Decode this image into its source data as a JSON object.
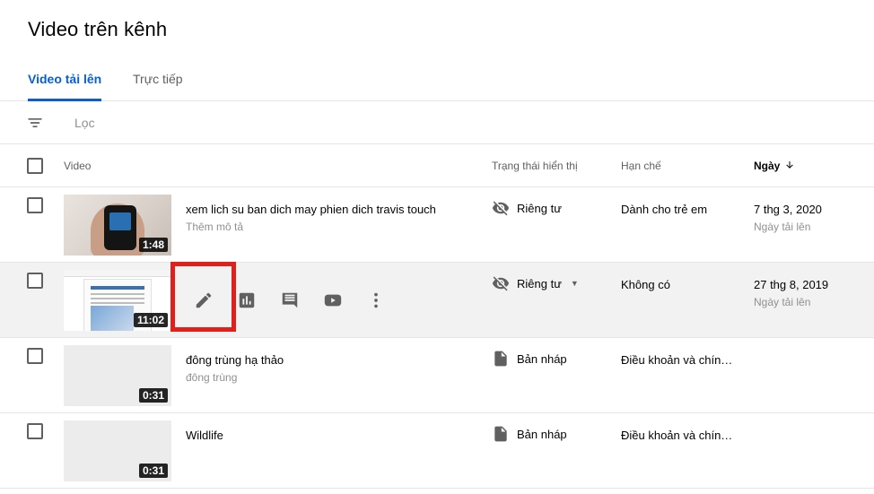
{
  "page": {
    "title": "Video trên kênh"
  },
  "tabs": [
    {
      "label": "Video tải lên",
      "active": true
    },
    {
      "label": "Trực tiếp",
      "active": false
    }
  ],
  "filter": {
    "icon": "filter-icon",
    "placeholder": "Lọc"
  },
  "table": {
    "headers": {
      "video": "Video",
      "visibility": "Trạng thái hiển thị",
      "restrictions": "Hạn chế",
      "date": "Ngày",
      "sort_icon": "arrow-down-icon"
    },
    "rows": [
      {
        "title": "xem lich su ban dich may phien dich travis touch",
        "description": "Thêm mô tả",
        "duration": "1:48",
        "visibility": "Riêng tư",
        "visibility_icon": "eye-off-icon",
        "restriction": "Dành cho trẻ em",
        "date": "7 thg 3, 2020",
        "date_label": "Ngày tải lên"
      },
      {
        "title": "",
        "description": "",
        "duration": "11:02",
        "visibility": "Riêng tư",
        "visibility_icon": "eye-off-icon",
        "restriction": "Không có",
        "date": "27 thg 8, 2019",
        "date_label": "Ngày tải lên",
        "actions": [
          "edit-icon",
          "analytics-icon",
          "comments-icon",
          "youtube-icon",
          "more-vert-icon"
        ]
      },
      {
        "title": "đông trùng hạ thảo",
        "description": "đông trùng",
        "duration": "0:31",
        "visibility": "Bản nháp",
        "visibility_icon": "draft-icon",
        "restriction": "Điều khoản và chín…",
        "date": "",
        "date_label": ""
      },
      {
        "title": "Wildlife",
        "description": "",
        "duration": "0:31",
        "visibility": "Bản nháp",
        "visibility_icon": "draft-icon",
        "restriction": "Điều khoản và chín…",
        "date": "",
        "date_label": ""
      }
    ]
  },
  "colors": {
    "accent": "#065fd4",
    "highlight": "#e0201b",
    "row_hover": "#f2f2f2"
  }
}
